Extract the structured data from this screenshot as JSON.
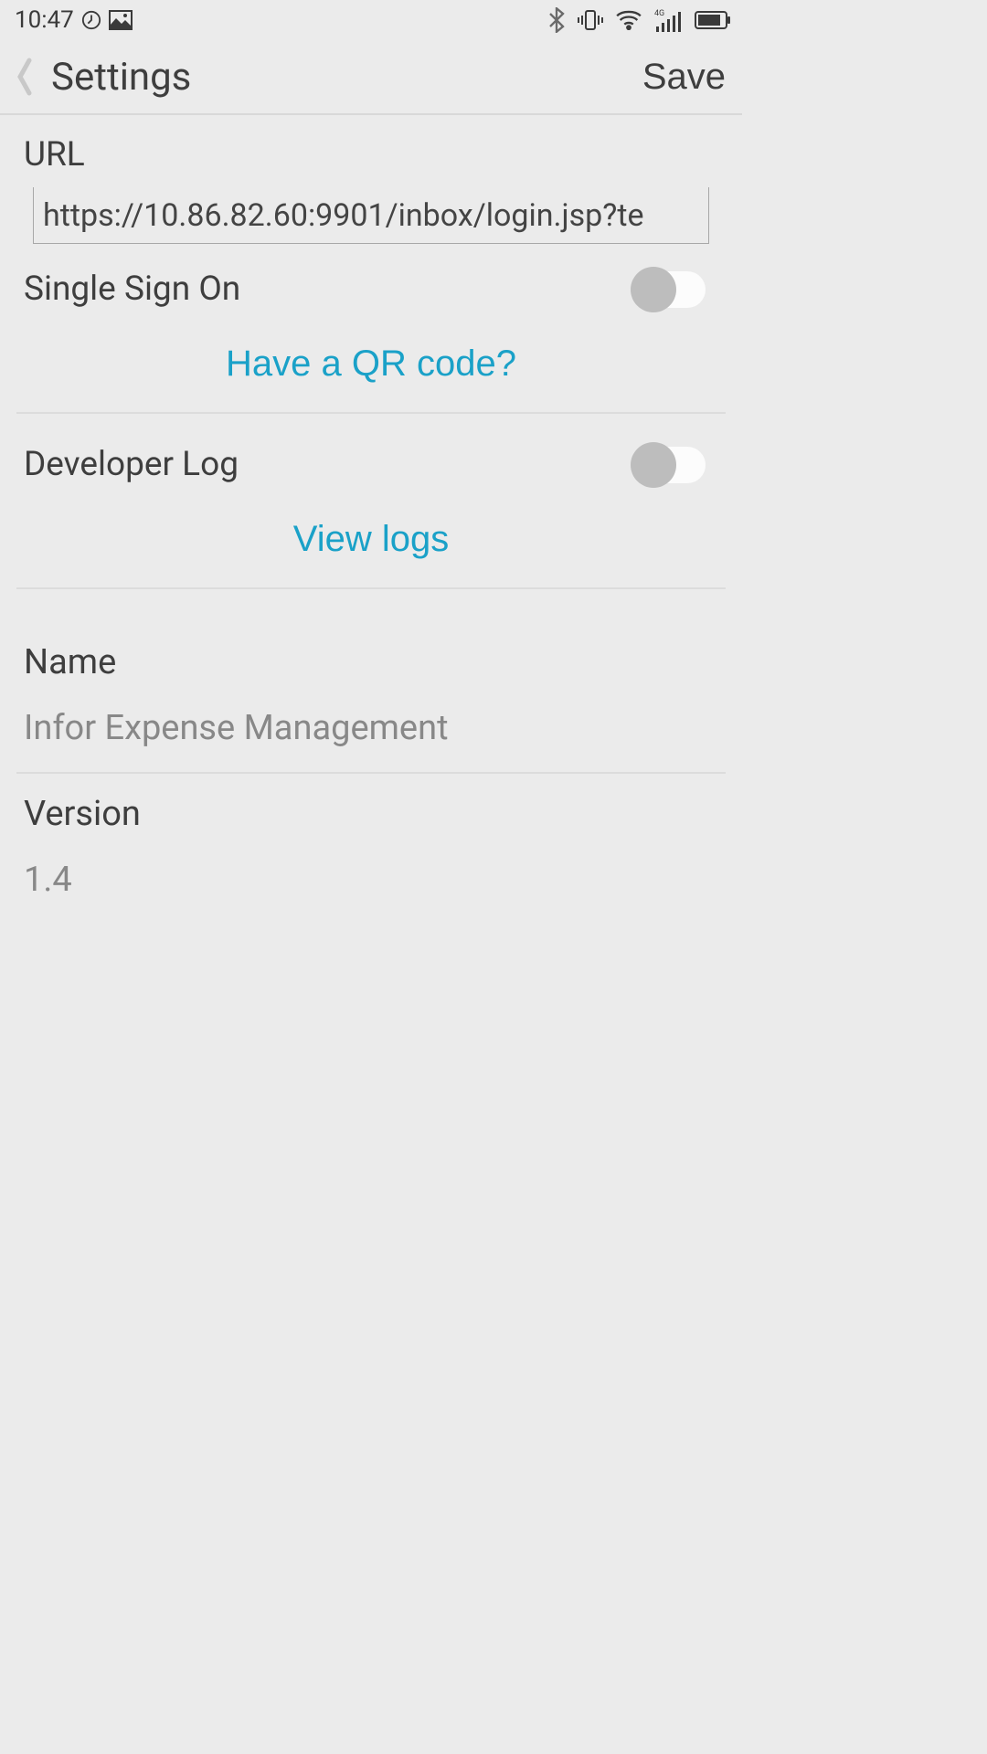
{
  "status_bar": {
    "time": "10:47"
  },
  "header": {
    "title": "Settings",
    "save_label": "Save"
  },
  "url": {
    "label": "URL",
    "value": "https://10.86.82.60:9901/inbox/login.jsp?te"
  },
  "sso": {
    "label": "Single Sign On",
    "enabled": false
  },
  "qr": {
    "link_label": "Have a QR code?"
  },
  "devlog": {
    "label": "Developer Log",
    "enabled": false,
    "view_label": "View logs"
  },
  "name": {
    "label": "Name",
    "value": "Infor Expense Management"
  },
  "version": {
    "label": "Version",
    "value": "1.4"
  }
}
